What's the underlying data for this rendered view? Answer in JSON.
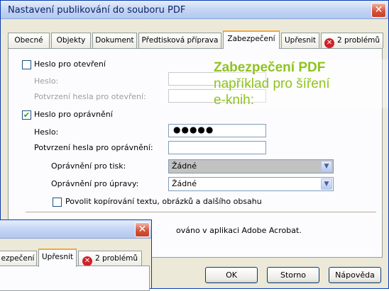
{
  "window": {
    "title": "Nastavení publikování do souboru PDF",
    "close_glyph": "✕"
  },
  "tabs": [
    {
      "label": "Obecné"
    },
    {
      "label": "Objekty"
    },
    {
      "label": "Dokument"
    },
    {
      "label": "Předtisková příprava"
    },
    {
      "label": "Zabezpečení",
      "active": true
    },
    {
      "label": "Upřesnit"
    },
    {
      "label": "2 problémů",
      "icon": "error-icon"
    }
  ],
  "error_glyph": "✕",
  "security": {
    "open_password": {
      "checkbox_label": "Heslo pro otevření",
      "checked": false,
      "password_label": "Heslo:",
      "confirm_label": "Potvrzení hesla pro otevření:",
      "password_value": "",
      "confirm_value": ""
    },
    "perm_password": {
      "checkbox_label": "Heslo pro oprávnění",
      "checked": true,
      "check_glyph": "✔",
      "password_label": "Heslo:",
      "password_value": "●●●●●",
      "confirm_label": "Potvrzení hesla pro oprávnění:",
      "confirm_value": "",
      "print_label": "Oprávnění pro tisk:",
      "print_value": "Žádné",
      "edit_label": "Oprávnění pro úpravy:",
      "edit_value": "Žádné",
      "copy_label": "Povolit kopírování textu, obrázků a dalšího obsahu",
      "copy_checked": false
    },
    "note_fragment": "ováno v aplikaci Adobe Acrobat."
  },
  "dropdown_arrow": "▼",
  "buttons": {
    "ok": "OK",
    "cancel": "Storno",
    "help": "Nápověda"
  },
  "overlay": {
    "line1": "Zabezpečení PDF",
    "line2": "například pro šíření",
    "line3": "e-knih:"
  },
  "second_window": {
    "tabs": [
      {
        "label": "ezpečení"
      },
      {
        "label": "Upřesnit",
        "active": true
      },
      {
        "label": "2 problémů",
        "icon": "error-icon"
      }
    ]
  },
  "colors": {
    "overlay_text": "#8fc31f",
    "tab_accent": "#f5a83a",
    "error_red": "#d0202a"
  }
}
